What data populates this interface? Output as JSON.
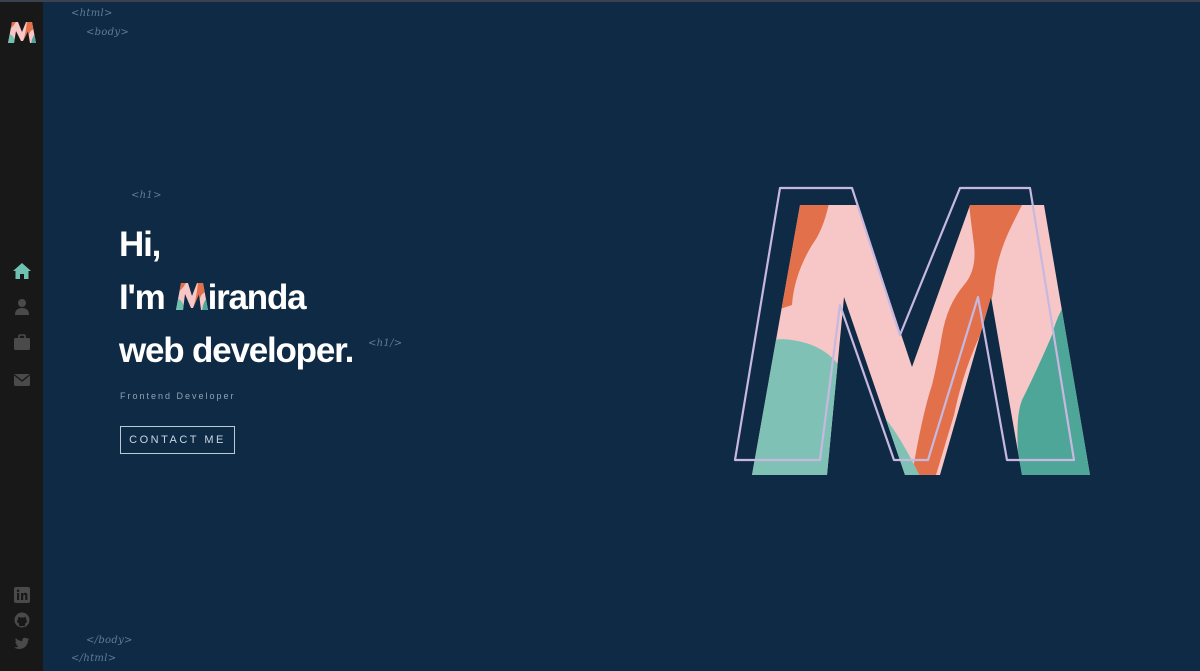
{
  "sidebar": {
    "logo_letter": "M",
    "nav": [
      {
        "name": "home",
        "icon": "home-icon",
        "active": true
      },
      {
        "name": "about",
        "icon": "user-icon",
        "active": false
      },
      {
        "name": "work",
        "icon": "briefcase-icon",
        "active": false
      },
      {
        "name": "contact",
        "icon": "envelope-icon",
        "active": false
      }
    ],
    "social": [
      {
        "name": "linkedin",
        "icon": "linkedin-icon"
      },
      {
        "name": "github",
        "icon": "github-icon"
      },
      {
        "name": "twitter",
        "icon": "twitter-icon"
      }
    ]
  },
  "code_tags": {
    "html_open": "<html>",
    "body_open": "<body>",
    "h1_open": "<h1>",
    "h1_close": "<h1/>",
    "body_close": "</body>",
    "html_close": "</html>"
  },
  "hero": {
    "line1": "Hi,",
    "line2_prefix": "I'm",
    "line2_initial": "M",
    "line2_rest": "iranda",
    "line3": "web developer.",
    "subtitle": "Frontend Developer",
    "cta_label": "CONTACT ME"
  },
  "colors": {
    "background": "#0f2a44",
    "sidebar": "#181818",
    "accent_teal": "#6fc2b0",
    "accent_pink": "#f7c7c7",
    "accent_orange": "#e2704a",
    "outline_lavender": "#c7b8e0",
    "text": "#ffffff"
  }
}
